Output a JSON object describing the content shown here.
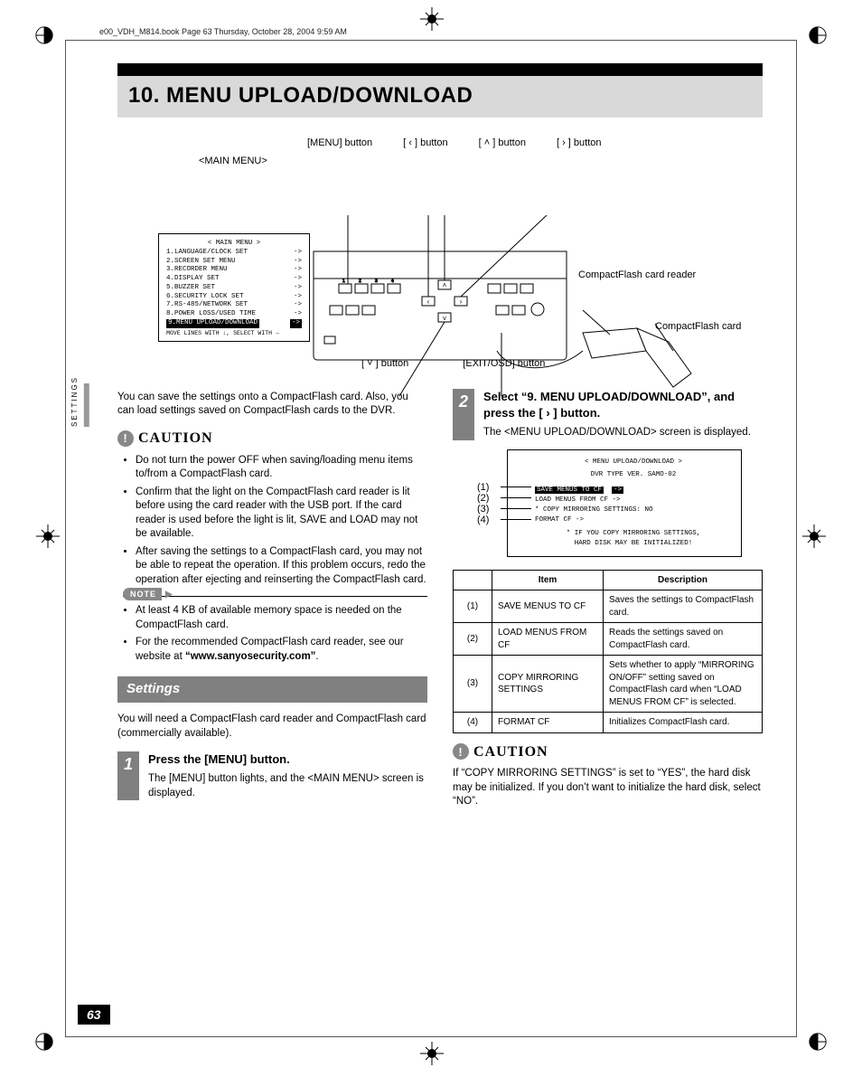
{
  "header_line": "e00_VDH_M814.book  Page 63  Thursday, October 28, 2004  9:59 AM",
  "page_number": "63",
  "title": "10. MENU UPLOAD/DOWNLOAD",
  "side_tab": "SETTINGS",
  "diagram": {
    "main_menu_label": "<MAIN MENU>",
    "btn_menu": "[MENU] button",
    "btn_left": "[ ‹ ] button",
    "btn_up": "[ ˄ ] button",
    "btn_right": "[ › ] button",
    "btn_down": "[ ˅ ] button",
    "btn_exit": "[EXIT/OSD] button",
    "cf_reader": "CompactFlash card reader",
    "cf_card": "CompactFlash card",
    "menu_title": "< MAIN MENU >",
    "menu_items": [
      "1.LANGUAGE/CLOCK SET",
      "2.SCREEN SET MENU",
      "3.RECORDER MENU",
      "4.DISPLAY SET",
      "5.BUZZER SET",
      "6.SECURITY LOCK SET",
      "7.RS-485/NETWORK SET",
      "8.POWER LOSS/USED TIME"
    ],
    "menu_highlight": "9.MENU UPLOAD/DOWNLOAD",
    "menu_footer": "MOVE LINES WITH ↕, SELECT WITH →"
  },
  "intro": "You can save the settings onto a CompactFlash card. Also, you can load settings saved on CompactFlash cards to the DVR.",
  "caution_label": "CAUTION",
  "caution_items": [
    "Do not turn the power OFF when saving/loading menu items to/from a CompactFlash card.",
    "Confirm that the light on the CompactFlash card reader is lit before using the card reader with the USB port. If the card reader is used before the light is lit, SAVE and LOAD may not be available.",
    "After saving the settings to a CompactFlash card, you may not be able to repeat the operation. If this problem occurs, redo the operation after ejecting and reinserting the CompactFlash card."
  ],
  "note_label": "NOTE",
  "note_items": [
    "At least 4 KB of available memory space is needed on the CompactFlash card.",
    "For the recommended CompactFlash card reader, see our website at “www.sanyosecurity.com”."
  ],
  "note_bold_tail": "“www.sanyosecurity.com”",
  "settings_heading": "Settings",
  "settings_intro": "You will need a CompactFlash card reader and CompactFlash card (commercially available).",
  "step1": {
    "num": "1",
    "title": "Press the [MENU] button.",
    "body": "The [MENU] button lights, and the <MAIN MENU> screen is displayed."
  },
  "step2": {
    "num": "2",
    "title": "Select “9. MENU UPLOAD/DOWNLOAD”, and press the [ › ] button.",
    "body": "The <MENU UPLOAD/DOWNLOAD> screen is displayed."
  },
  "mini": {
    "title": "< MENU UPLOAD/DOWNLOAD >",
    "ver": "DVR TYPE VER.   SAMO-02",
    "row1": "SAVE MENUS TO CF",
    "row2": "LOAD MENUS FROM CF   ->",
    "row3": "* COPY MIRRORING SETTINGS: NO",
    "row4": "FORMAT CF            ->",
    "foot1": "* IF YOU COPY MIRRORING SETTINGS,",
    "foot2": "  HARD DISK MAY BE INITIALIZED!",
    "k1": "(1)",
    "k2": "(2)",
    "k3": "(3)",
    "k4": "(4)"
  },
  "table": {
    "h1": "Item",
    "h2": "Description",
    "rows": [
      {
        "n": "(1)",
        "item": "SAVE MENUS TO CF",
        "desc": "Saves the settings to CompactFlash card."
      },
      {
        "n": "(2)",
        "item": "LOAD MENUS FROM CF",
        "desc": "Reads the settings saved on CompactFlash card."
      },
      {
        "n": "(3)",
        "item": "COPY MIRRORING SETTINGS",
        "desc": "Sets whether to apply “MIRRORING ON/OFF” setting saved on CompactFlash card when “LOAD MENUS FROM CF” is selected."
      },
      {
        "n": "(4)",
        "item": "FORMAT CF",
        "desc": "Initializes CompactFlash card."
      }
    ]
  },
  "caution2": "If “COPY MIRRORING SETTINGS” is set to “YES”, the hard disk may be initialized. If you don’t want to initialize the hard disk, select “NO”."
}
